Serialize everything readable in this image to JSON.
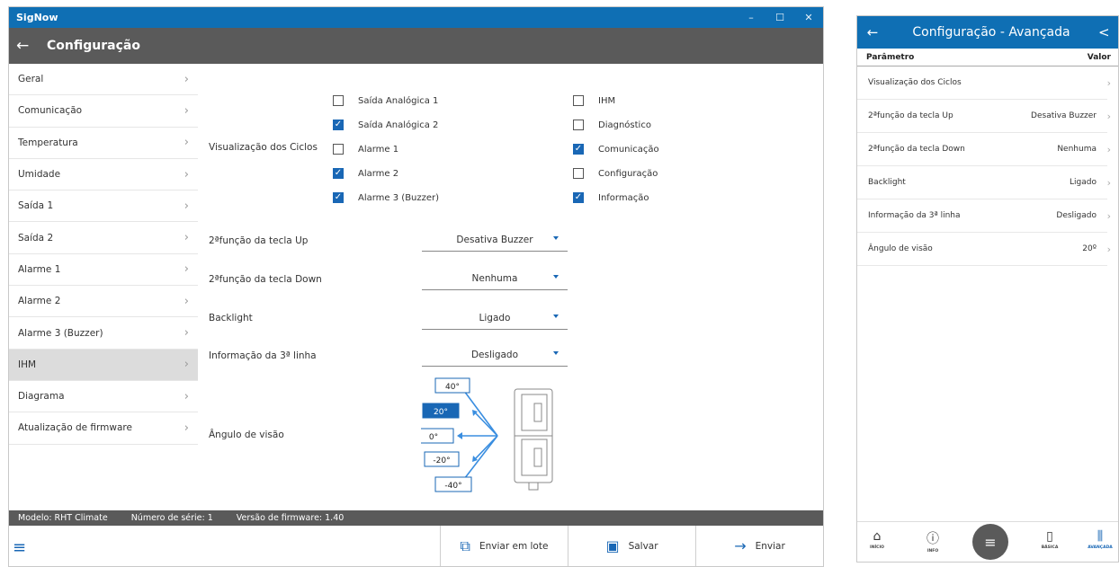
{
  "desktop": {
    "app_title": "SigNow",
    "window_controls": [
      "–",
      "☐",
      "✕"
    ],
    "header_title": "Configuração",
    "sidebar": [
      {
        "label": "Geral"
      },
      {
        "label": "Comunicação"
      },
      {
        "label": "Temperatura"
      },
      {
        "label": "Umidade"
      },
      {
        "label": "Saída 1"
      },
      {
        "label": "Saída 2"
      },
      {
        "label": "Alarme 1"
      },
      {
        "label": "Alarme 2"
      },
      {
        "label": "Alarme 3 (Buzzer)"
      },
      {
        "label": "IHM",
        "active": true
      },
      {
        "label": "Diagrama"
      },
      {
        "label": "Atualização de firmware"
      }
    ],
    "visualizacao": {
      "label": "Visualização dos Ciclos",
      "col1": [
        {
          "label": "Saída Analógica 1",
          "checked": false
        },
        {
          "label": "Saída Analógica 2",
          "checked": true
        },
        {
          "label": "Alarme 1",
          "checked": false
        },
        {
          "label": "Alarme 2",
          "checked": true
        },
        {
          "label": "Alarme 3 (Buzzer)",
          "checked": true
        }
      ],
      "col2": [
        {
          "label": "IHM",
          "checked": false
        },
        {
          "label": "Diagnóstico",
          "checked": false
        },
        {
          "label": "Comunicação",
          "checked": true
        },
        {
          "label": "Configuração",
          "checked": false
        },
        {
          "label": "Informação",
          "checked": true
        }
      ]
    },
    "settings": [
      {
        "label": "2ªfunção da tecla Up",
        "value": "Desativa Buzzer"
      },
      {
        "label": "2ªfunção da tecla Down",
        "value": "Nenhuma"
      },
      {
        "label": "Backlight",
        "value": "Ligado"
      },
      {
        "label": "Informação da 3ª linha",
        "value": "Desligado"
      }
    ],
    "angulo": {
      "label": "Ângulo de visão",
      "options": [
        "40°",
        "20°",
        "0°",
        "-20°",
        "-40°"
      ],
      "selected": "20°"
    },
    "status": {
      "modelo": "Modelo: RHT Climate",
      "serie": "Número de série: 1",
      "firmware": "Versão de firmware: 1.40"
    },
    "buttons": {
      "lote": "Enviar em lote",
      "salvar": "Salvar",
      "enviar": "Enviar"
    },
    "accent_color": "#1967b5",
    "titlebar_color": "#0f6fb4",
    "header_color": "#5a5a5a"
  },
  "mobile": {
    "title": "Configuração - Avançada",
    "col_param": "Parâmetro",
    "col_valor": "Valor",
    "rows": [
      {
        "label": "Visualização dos Ciclos",
        "value": ""
      },
      {
        "label": "2ªfunção da tecla Up",
        "value": "Desativa Buzzer"
      },
      {
        "label": "2ªfunção da tecla Down",
        "value": "Nenhuma"
      },
      {
        "label": "Backlight",
        "value": "Ligado"
      },
      {
        "label": "Informação da 3ª linha",
        "value": "Desligado"
      },
      {
        "label": "Ângulo de visão",
        "value": "20º"
      }
    ],
    "nav": {
      "inicio": "INÍCIO",
      "info": "INFO",
      "basica": "BÁSICA",
      "avancada": "AVANÇADA"
    }
  }
}
